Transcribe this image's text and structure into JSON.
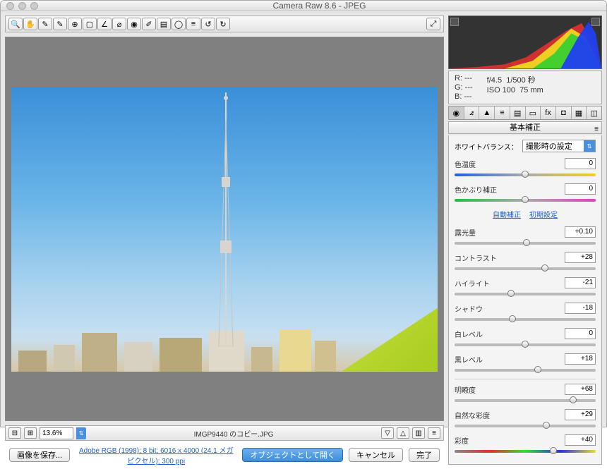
{
  "title": "Camera Raw 8.6  -  JPEG",
  "zoom": "13.6%",
  "filename": "IMGP9440 のコピー.JPG",
  "metadata_link": "Adobe RGB (1998); 8 bit; 6016 x 4000 (24.1 メガピクセル); 300 ppi",
  "buttons": {
    "save_image": "画像を保存...",
    "open_object": "オブジェクトとして開く",
    "cancel": "キャンセル",
    "done": "完了"
  },
  "exif": {
    "r": "R:   ---",
    "g": "G:   ---",
    "b": "B:   ---",
    "aperture": "f/4.5",
    "shutter": "1/500 秒",
    "iso": "ISO 100",
    "focal": "75 mm"
  },
  "panel_title": "基本補正",
  "wb": {
    "label": "ホワイトバランス：",
    "value": "撮影時の設定"
  },
  "links": {
    "auto": "自動補正",
    "default": "初期設定"
  },
  "sliders": {
    "temp": {
      "label": "色温度",
      "value": "0",
      "pos": 50,
      "grad": "linear-gradient(90deg,#2060e0,#aaa,#f0d020)"
    },
    "tint": {
      "label": "色かぶり補正",
      "value": "0",
      "pos": 50,
      "grad": "linear-gradient(90deg,#20c040,#aaa,#e040c0)"
    },
    "exposure": {
      "label": "露光量",
      "value": "+0.10",
      "pos": 51,
      "grad": "#bbb"
    },
    "contrast": {
      "label": "コントラスト",
      "value": "+28",
      "pos": 64,
      "grad": "#bbb"
    },
    "highlight": {
      "label": "ハイライト",
      "value": "-21",
      "pos": 40,
      "grad": "#bbb"
    },
    "shadow": {
      "label": "シャドウ",
      "value": "-18",
      "pos": 41,
      "grad": "#bbb"
    },
    "white": {
      "label": "白レベル",
      "value": "0",
      "pos": 50,
      "grad": "#bbb"
    },
    "black": {
      "label": "黒レベル",
      "value": "+18",
      "pos": 59,
      "grad": "#bbb"
    },
    "clarity": {
      "label": "明瞭度",
      "value": "+68",
      "pos": 84,
      "grad": "#bbb"
    },
    "vibrance": {
      "label": "自然な彩度",
      "value": "+29",
      "pos": 65,
      "grad": "#bbb"
    },
    "sat": {
      "label": "彩度",
      "value": "+40",
      "pos": 70,
      "grad": "linear-gradient(90deg,#888,#e03030,#30e030,#3030e0,#e0e030)"
    }
  }
}
